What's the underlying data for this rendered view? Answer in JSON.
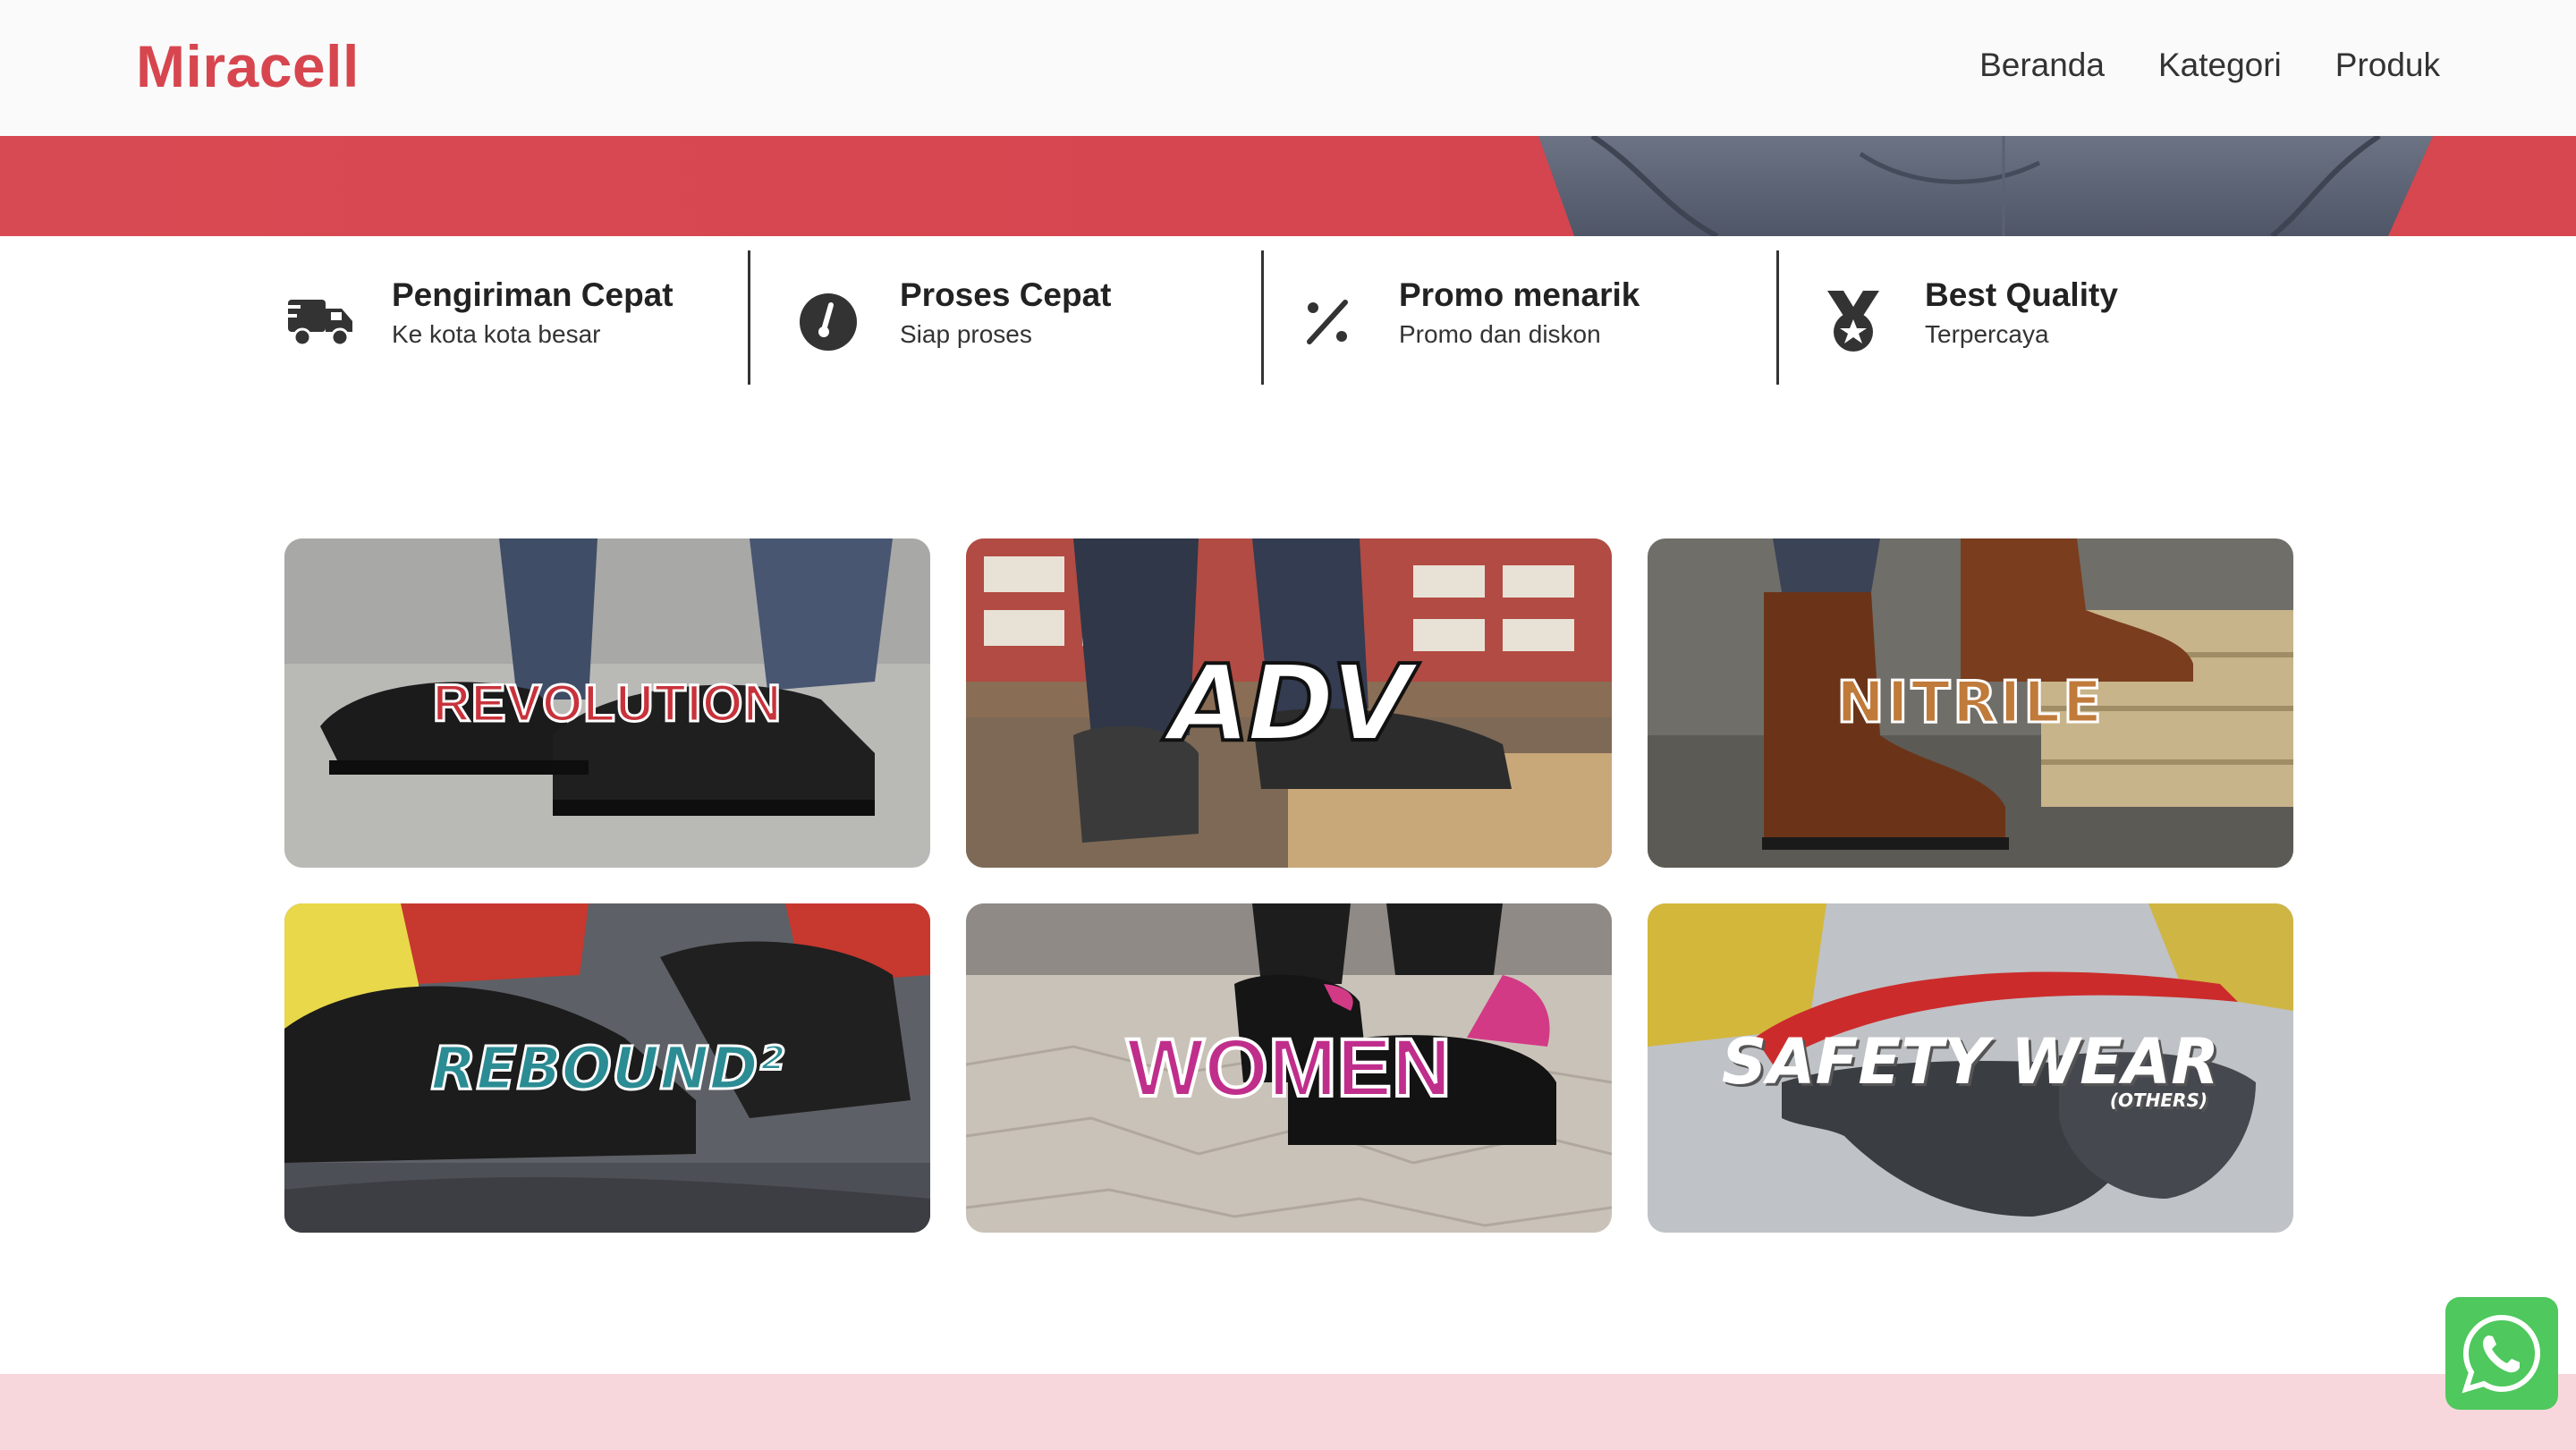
{
  "header": {
    "logo": "Miracell",
    "nav": [
      "Beranda",
      "Kategori",
      "Produk"
    ]
  },
  "features": [
    {
      "title": "Pengiriman Cepat",
      "subtitle": "Ke kota kota besar",
      "icon": "truck-icon"
    },
    {
      "title": "Proses Cepat",
      "subtitle": "Siap proses",
      "icon": "gauge-icon"
    },
    {
      "title": "Promo menarik",
      "subtitle": "Promo dan diskon",
      "icon": "percent-icon"
    },
    {
      "title": "Best Quality",
      "subtitle": "Terpercaya",
      "icon": "medal-icon"
    }
  ],
  "categories": [
    {
      "label": "REVOLUTION"
    },
    {
      "label": "ADV"
    },
    {
      "label": "NITRILE"
    },
    {
      "label": "REBOUND²"
    },
    {
      "label": "WOMEN"
    },
    {
      "label": "SAFETY WEAR",
      "sublabel": "(OTHERS)"
    }
  ],
  "colors": {
    "brand": "#d7464f",
    "whatsapp": "#4fc85d",
    "footer": "#f7d7dc"
  },
  "floating": {
    "icon": "whatsapp-icon"
  }
}
